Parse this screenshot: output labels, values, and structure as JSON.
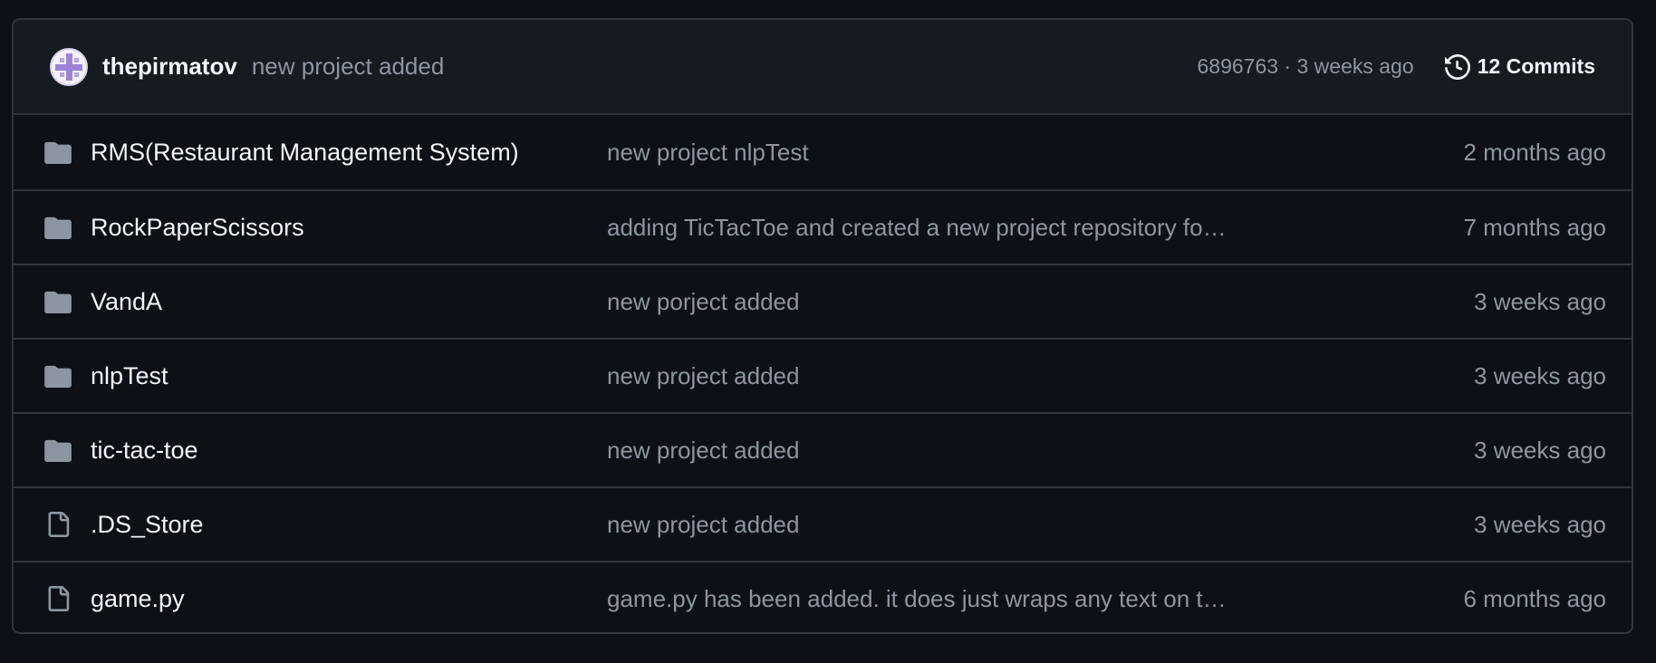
{
  "colors": {
    "background": "#0d1117",
    "header_background": "#161b22",
    "border": "#30363d",
    "primary_text": "#f0f6fc",
    "muted_text": "#8d96a0",
    "folder_icon": "#8d96a0"
  },
  "header": {
    "author": "thepirmatov",
    "message": "new project added",
    "hash_time": "6896763 · 3 weeks ago",
    "commits_label": "12 Commits",
    "commits_icon": "history-icon"
  },
  "files": [
    {
      "type": "folder",
      "icon": "folder-icon",
      "name": "RMS(Restaurant Management System)",
      "message": "new project nlpTest",
      "age": "2 months ago"
    },
    {
      "type": "folder",
      "icon": "folder-icon",
      "name": "RockPaperScissors",
      "message": "adding TicTacToe and created a new project repository fo…",
      "age": "7 months ago"
    },
    {
      "type": "folder",
      "icon": "folder-icon",
      "name": "VandA",
      "message": "new porject added",
      "age": "3 weeks ago"
    },
    {
      "type": "folder",
      "icon": "folder-icon",
      "name": "nlpTest",
      "message": "new project added",
      "age": "3 weeks ago"
    },
    {
      "type": "folder",
      "icon": "folder-icon",
      "name": "tic-tac-toe",
      "message": "new project added",
      "age": "3 weeks ago"
    },
    {
      "type": "file",
      "icon": "file-icon",
      "name": ".DS_Store",
      "message": "new project added",
      "age": "3 weeks ago"
    },
    {
      "type": "file",
      "icon": "file-icon",
      "name": "game.py",
      "message": "game.py has been added. it does just wraps any text on t…",
      "age": "6 months ago"
    }
  ]
}
